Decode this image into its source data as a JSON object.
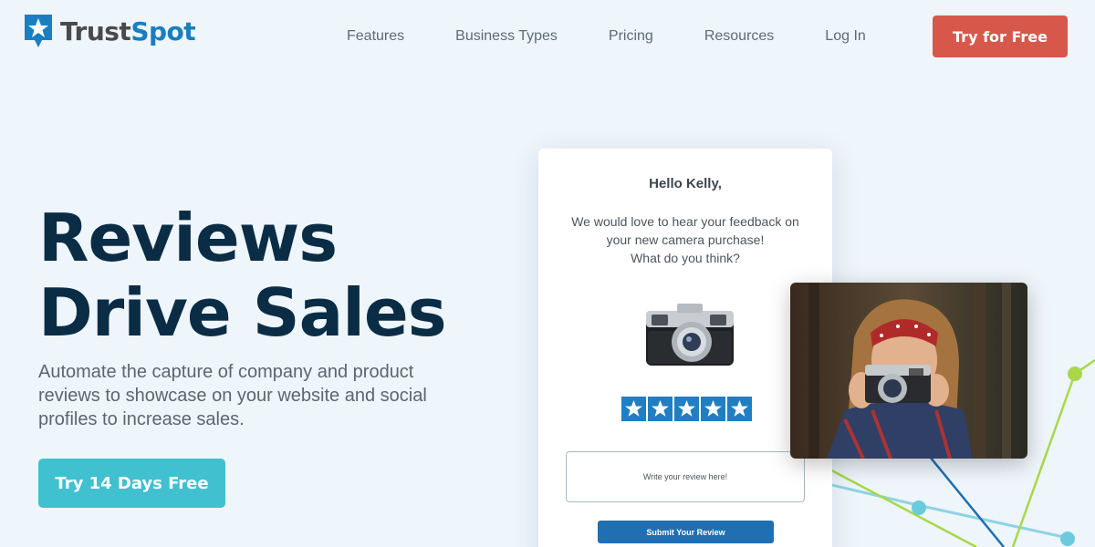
{
  "brand": {
    "name_part1": "Trust",
    "name_part2": "Spot"
  },
  "nav": {
    "items": [
      "Features",
      "Business Types",
      "Pricing",
      "Resources",
      "Log In"
    ],
    "cta_label": "Try for Free"
  },
  "hero": {
    "title_line1": "Reviews",
    "title_line2": "Drive Sales",
    "subtitle": "Automate the capture of company and product reviews to showcase on your website and social profiles to increase sales.",
    "cta_label": "Try 14 Days Free"
  },
  "review_card": {
    "greeting": "Hello Kelly,",
    "message_line1": "We would love to hear your feedback on",
    "message_line2": "your new camera purchase!",
    "message_line3": "What do you think?",
    "rating": 5,
    "review_placeholder": "Write your review here!",
    "submit_label": "Submit Your Review"
  },
  "colors": {
    "brand_blue": "#1a7ebf",
    "title_navy": "#0b2c45",
    "header_cta": "#d8574b",
    "hero_cta": "#41c0cf",
    "background": "#eef5fb"
  }
}
